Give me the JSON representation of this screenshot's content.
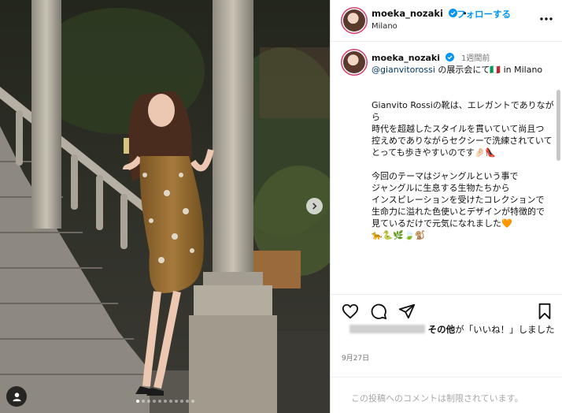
{
  "post": {
    "username": "moeka_nozaki",
    "follow_label": "フォローする",
    "follow_separator": "•",
    "location": "Milano",
    "carousel": {
      "current": 1,
      "total": 11
    }
  },
  "caption": {
    "username": "moeka_nozaki",
    "time": "1週間前",
    "mention": "@gianvitorossi",
    "first_line_rest": " の展示会にて🇮🇹 in Milano",
    "paragraphs": [
      "Gianvito Rossiの靴は、エレガントでありながら\n時代を超越したスタイルを貫いていて尚且つ\n控えめでありながらセクシーで洗練されていて\nとっても歩きやすいのです🤌🏻👠",
      "今回のテーマはジャングルという事で\nジャングルに生息する生物たちから\nインスピレーションを受けたコレクションで\n生命力に溢れた色使いとデザインが特徴的で\n見ているだけで元気になれました🧡\n🐆🐍🌿🍃🐒"
    ]
  },
  "likes": {
    "suffix_bold": "その他",
    "suffix_text": "が「いいね！」しました"
  },
  "date": "9月27日",
  "comment_notice": "この投稿へのコメントは制限されています。",
  "icons": {
    "verified": "verified-badge-icon",
    "more": "more-options-icon",
    "like": "heart-icon",
    "comment": "comment-icon",
    "share": "share-icon",
    "save": "bookmark-icon",
    "next": "chevron-right-icon",
    "tag": "user-tag-icon"
  },
  "colors": {
    "accent": "#0095f6",
    "text": "#111111",
    "muted": "#737373",
    "verified": "#0095f6"
  }
}
